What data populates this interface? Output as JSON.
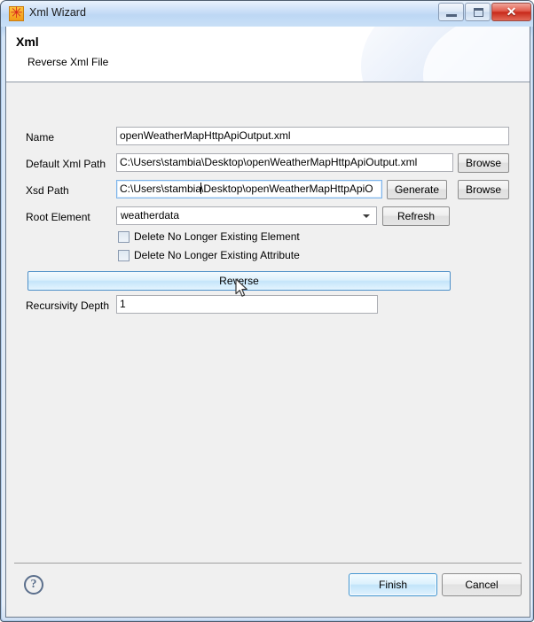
{
  "window": {
    "title": "Xml Wizard",
    "icon": "stambia-logo-icon",
    "controls": {
      "minimize": "minimize-button",
      "maximize": "maximize-button",
      "close_glyph": "✕"
    }
  },
  "banner": {
    "title": "Xml",
    "subtitle": "Reverse Xml File"
  },
  "form": {
    "name": {
      "label": "Name",
      "value": "openWeatherMapHttpApiOutput.xml"
    },
    "default_xml_path": {
      "label": "Default Xml Path",
      "value": "C:\\Users\\stambia\\Desktop\\openWeatherMapHttpApiOutput.xml",
      "browse_label": "Browse"
    },
    "xsd_path": {
      "label": "Xsd Path",
      "value_before_caret": "C:\\Users\\stambia",
      "value_after_caret": "\\Desktop\\openWeatherMapHttpApiO",
      "generate_label": "Generate",
      "browse_label": "Browse"
    },
    "root_element": {
      "label": "Root Element",
      "value": "weatherdata",
      "options": [
        "weatherdata"
      ],
      "refresh_label": "Refresh"
    },
    "delete_element_checkbox": {
      "label": "Delete No Longer Existing Element",
      "checked": false
    },
    "delete_attribute_checkbox": {
      "label": "Delete No Longer Existing Attribute",
      "checked": false
    },
    "reverse_button": {
      "label": "Reverse"
    },
    "recursivity_depth": {
      "label": "Recursivity Depth",
      "value": "1"
    }
  },
  "footer": {
    "help_glyph": "?",
    "finish_label": "Finish",
    "cancel_label": "Cancel"
  },
  "colors": {
    "titlebar": "#bdd7f4",
    "dialog_bg": "#f0f0f0",
    "accent": "#4f90c8",
    "close_red": "#c8291a",
    "icon_orange": "#f29a18"
  }
}
